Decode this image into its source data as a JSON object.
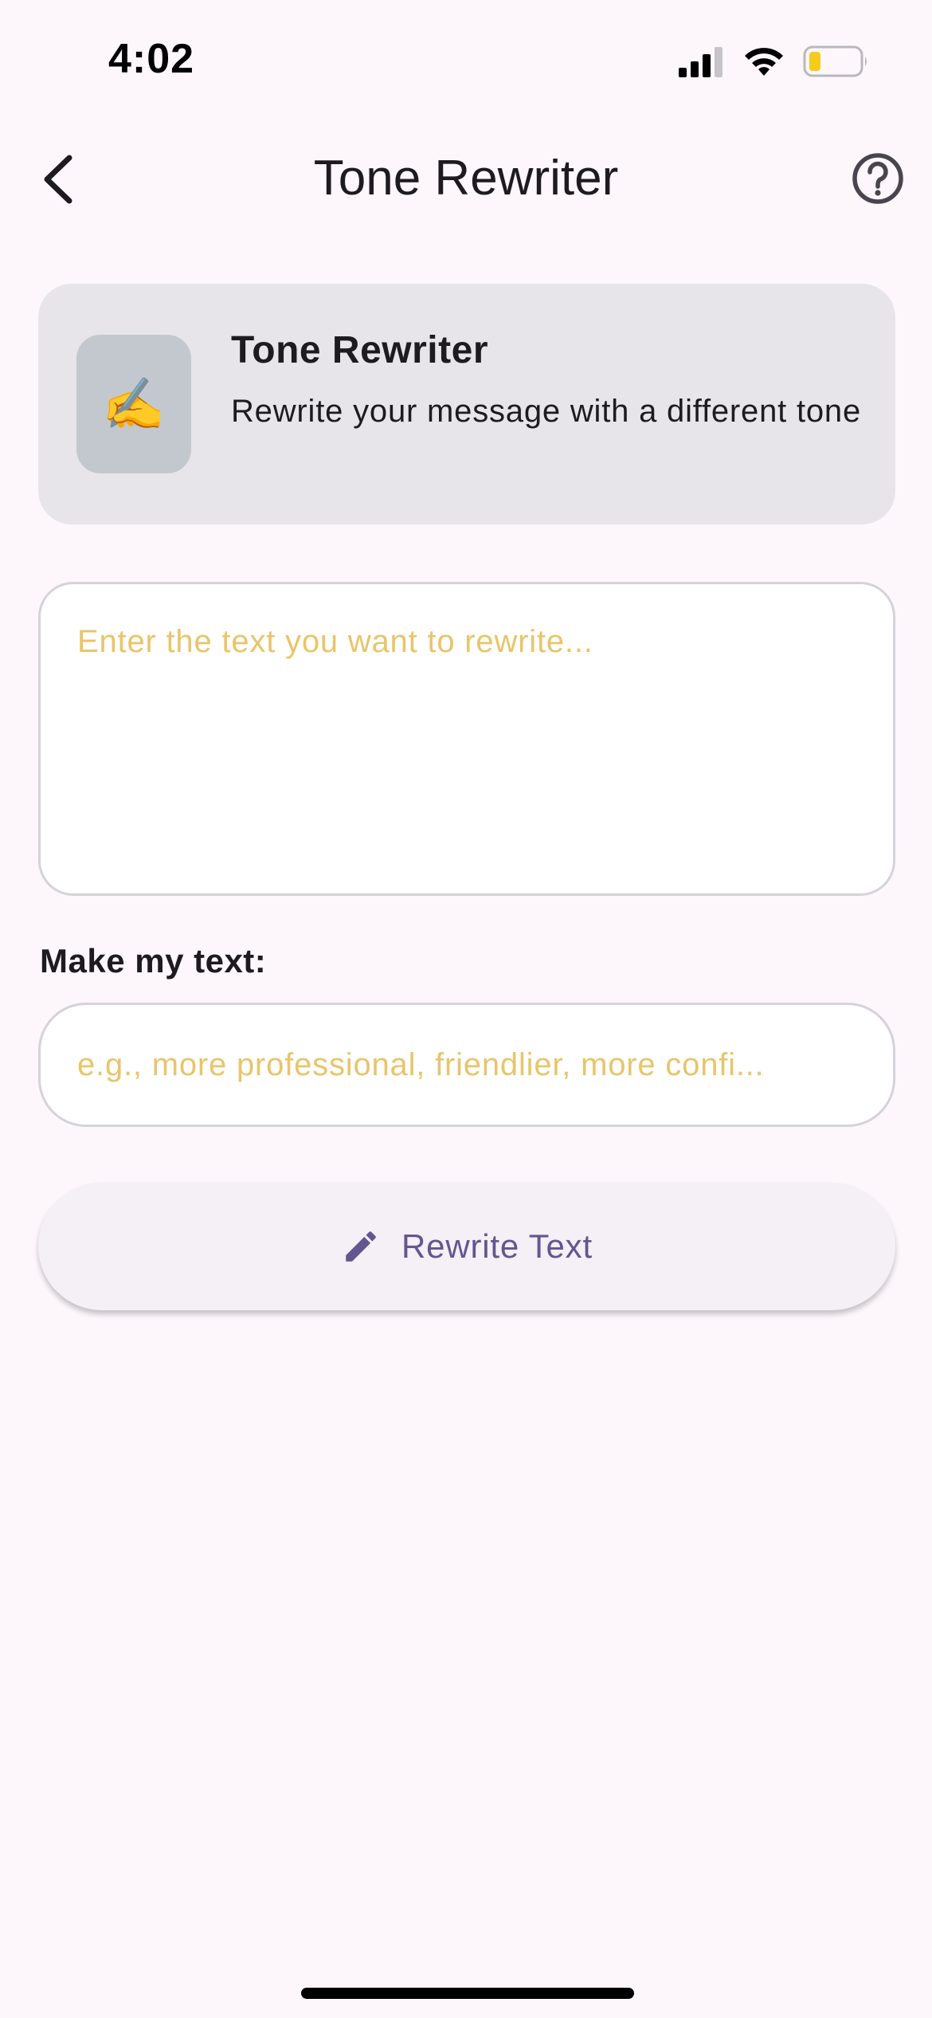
{
  "status_bar": {
    "time": "4:02",
    "battery_color": "#f5cc1a"
  },
  "app_bar": {
    "title": "Tone Rewriter",
    "back_icon": "chevron-left-icon",
    "help_icon": "help-circle-icon"
  },
  "info_card": {
    "icon_emoji": "✍️",
    "title": "Tone Rewriter",
    "description": "Rewrite your message with a different tone"
  },
  "input": {
    "text_value": "",
    "text_placeholder": "Enter the text you want to rewrite...",
    "tone_label": "Make my text:",
    "tone_value": "",
    "tone_placeholder": "e.g., more professional, friendlier, more confi..."
  },
  "actions": {
    "rewrite_label": "Rewrite Text",
    "rewrite_icon": "pencil-icon"
  },
  "colors": {
    "background": "#fdf7fc",
    "card": "#e7e5ea",
    "icon_tile": "#c3c7ce",
    "placeholder": "#e8c56b",
    "accent": "#65558f"
  }
}
